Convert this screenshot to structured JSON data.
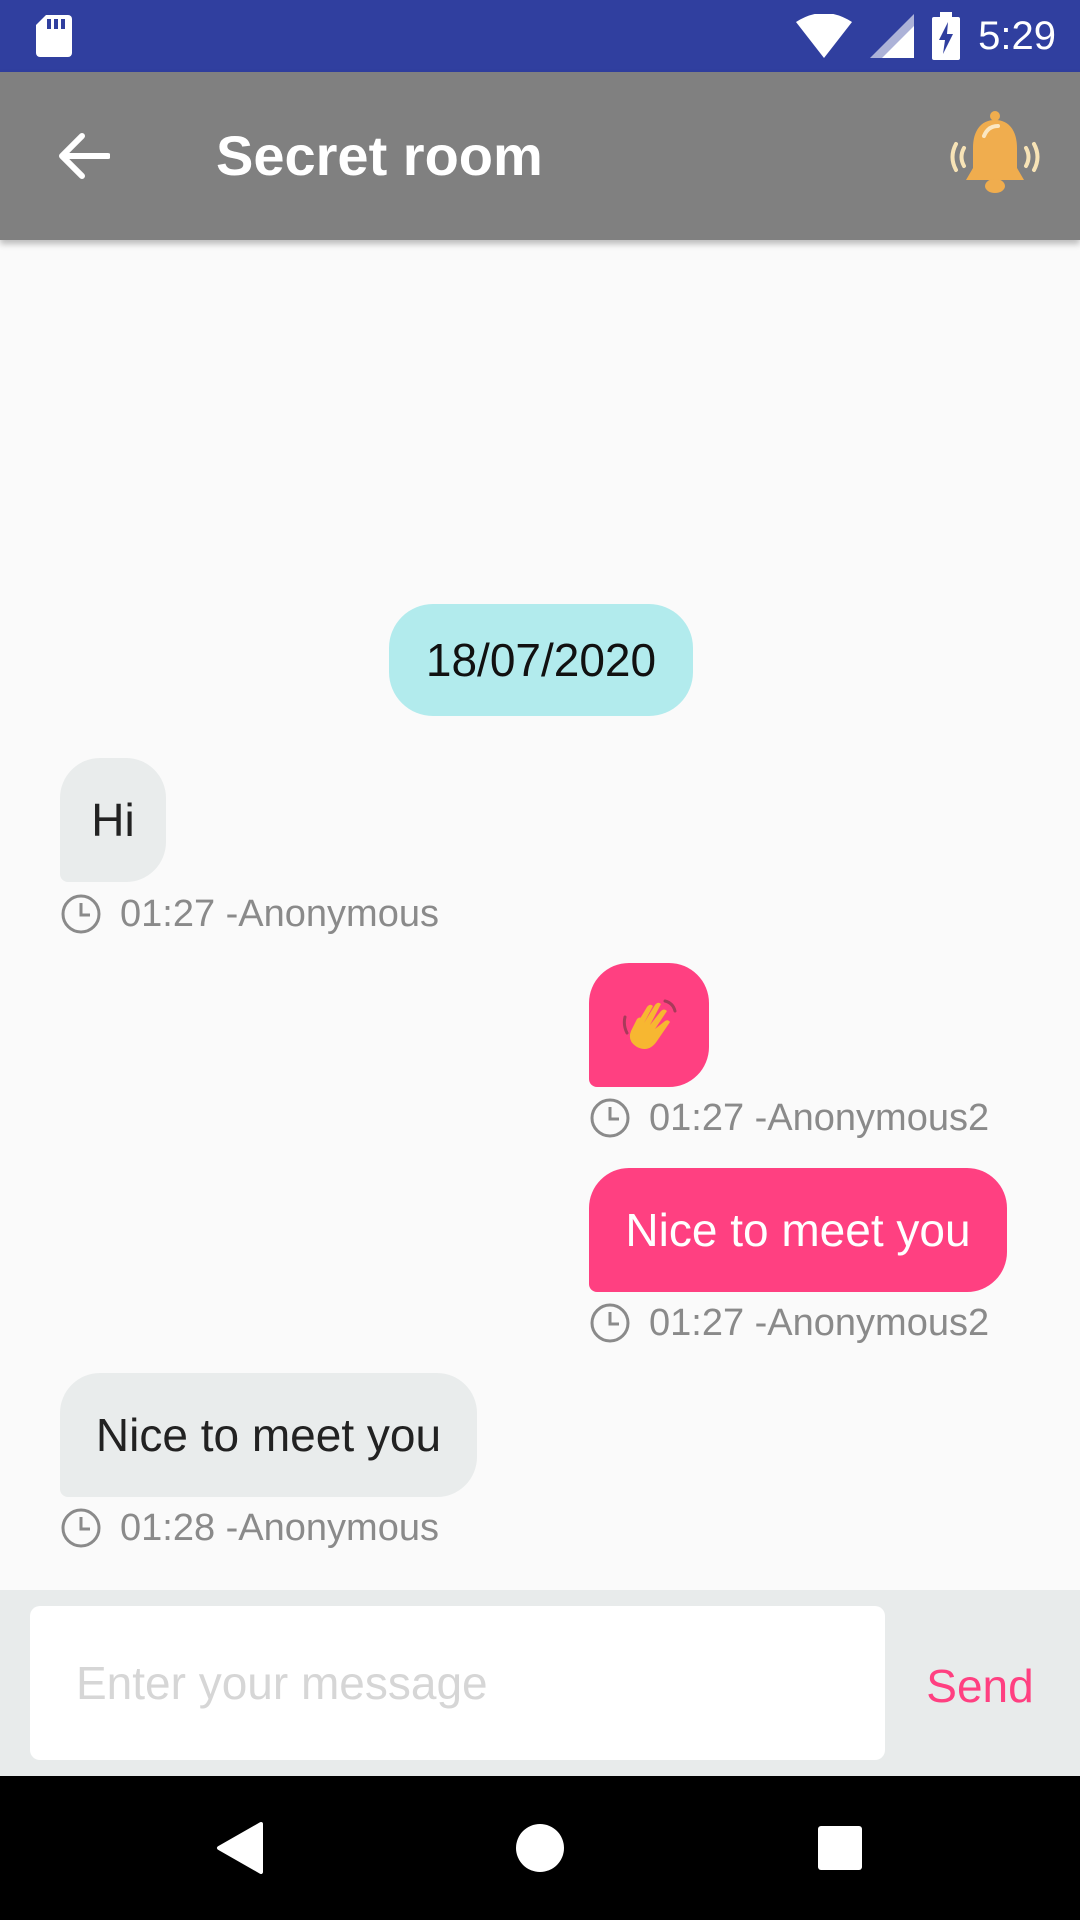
{
  "status_bar": {
    "time": "5:29",
    "icons": [
      "sd-card-icon",
      "wifi-icon",
      "cell-signal-icon",
      "battery-charging-icon"
    ]
  },
  "app_bar": {
    "title": "Secret room",
    "back_icon": "arrow-left-icon",
    "action_icon": "bell-ringing-icon"
  },
  "chat": {
    "date": "18/07/2020",
    "messages": [
      {
        "direction": "incoming",
        "text": "Hi",
        "meta": "01:27 -Anonymous"
      },
      {
        "direction": "outgoing",
        "text": "👋",
        "meta": "01:27 -Anonymous2"
      },
      {
        "direction": "outgoing",
        "text": "Nice to meet you",
        "meta": "01:27 -Anonymous2"
      },
      {
        "direction": "incoming",
        "text": "Nice to meet you",
        "meta": "01:28 -Anonymous"
      }
    ]
  },
  "composer": {
    "placeholder": "Enter your message",
    "value": "",
    "send_label": "Send"
  },
  "nav_bar": {
    "icons": [
      "back-triangle-icon",
      "home-circle-icon",
      "recents-square-icon"
    ]
  },
  "colors": {
    "status_bar": "#303f9f",
    "app_bar": "#808080",
    "accent": "#ff4081",
    "date_chip": "#b2ebed",
    "incoming_bubble": "#e9ecec",
    "bell": "#f0ad4e"
  }
}
